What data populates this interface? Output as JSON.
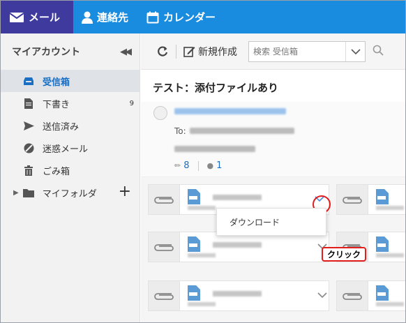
{
  "nav": {
    "mail": "メール",
    "contacts": "連絡先",
    "calendar": "カレンダー"
  },
  "sidebar": {
    "title": "マイアカウント",
    "items": [
      {
        "label": "受信箱"
      },
      {
        "label": "下書き",
        "count": "9"
      },
      {
        "label": "送信済み"
      },
      {
        "label": "迷惑メール"
      },
      {
        "label": "ごみ箱"
      },
      {
        "label": "マイフォルダ"
      }
    ]
  },
  "toolbar": {
    "new_label": "新規作成",
    "search_placeholder": "検索 受信箱"
  },
  "message": {
    "subject": "テスト：添付ファイルあり",
    "to_label": "To:",
    "attachment_count": "8",
    "recipient_count": "1"
  },
  "attachment_menu": {
    "download": "ダウンロード"
  },
  "annotation": {
    "click": "クリック"
  },
  "colors": {
    "nav_bg": "#1a8ce0",
    "nav_active": "#3f3a9e",
    "link_blue": "#1a6fc4",
    "callout_red": "#e31c1c"
  }
}
